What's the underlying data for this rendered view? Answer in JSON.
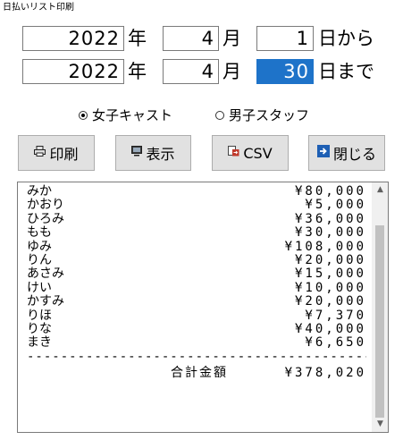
{
  "window": {
    "title": "日払いリスト印刷"
  },
  "date_from": {
    "year": "2022",
    "year_unit": "年",
    "month": "4",
    "month_unit": "月",
    "day": "1",
    "day_unit": "日から"
  },
  "date_to": {
    "year": "2022",
    "year_unit": "年",
    "month": "4",
    "month_unit": "月",
    "day": "30",
    "day_unit": "日まで"
  },
  "radios": {
    "female_cast": "女子キャスト",
    "male_staff": "男子スタッフ",
    "selected": "female_cast"
  },
  "buttons": {
    "print": "印刷",
    "display": "表示",
    "csv": "CSV",
    "close": "閉じる"
  },
  "list": {
    "rows": [
      {
        "name": "みか",
        "amount": "¥80,000"
      },
      {
        "name": "かおり",
        "amount": "¥5,000"
      },
      {
        "name": "ひろみ",
        "amount": "¥36,000"
      },
      {
        "name": "もも",
        "amount": "¥30,000"
      },
      {
        "name": "ゆみ",
        "amount": "¥108,000"
      },
      {
        "name": "りん",
        "amount": "¥20,000"
      },
      {
        "name": "あさみ",
        "amount": "¥15,000"
      },
      {
        "name": "けい",
        "amount": "¥10,000"
      },
      {
        "name": "かすみ",
        "amount": "¥20,000"
      },
      {
        "name": "りほ",
        "amount": "¥7,370"
      },
      {
        "name": "りな",
        "amount": "¥40,000"
      },
      {
        "name": "まき",
        "amount": "¥6,650"
      }
    ],
    "separator": "----------------------------------------------",
    "total_label": "合計金額",
    "total_amount": "¥378,020"
  },
  "icons": {
    "print": "printer-icon",
    "display": "monitor-icon",
    "csv": "csv-export-icon",
    "close": "exit-icon"
  },
  "colors": {
    "selection": "#1e73c9",
    "button_bg": "#e1e1e1",
    "close_icon": "#1e5fb4"
  }
}
